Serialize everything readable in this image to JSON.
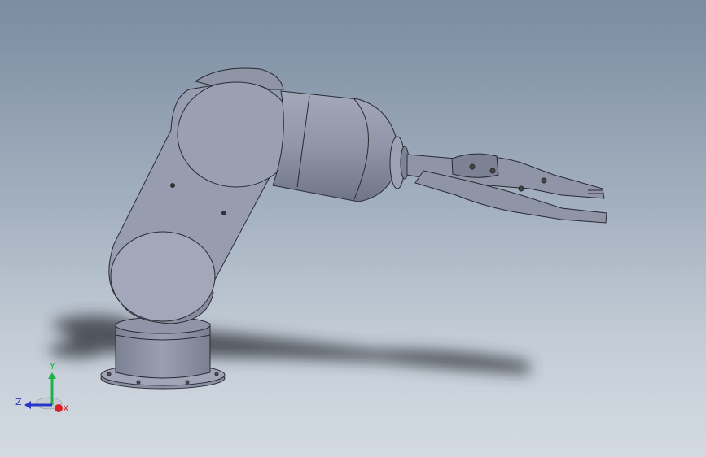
{
  "viewport": {
    "background_top": "#7b8ca1",
    "background_bottom": "#d3dae1",
    "model_color": "#8e93a6",
    "edge_color": "#2a2a33"
  },
  "triad": {
    "x_label": "X",
    "y_label": "Y",
    "z_label": "Z",
    "x_color": "#d8202a",
    "y_color": "#21b14b",
    "z_color": "#2a36c8"
  }
}
